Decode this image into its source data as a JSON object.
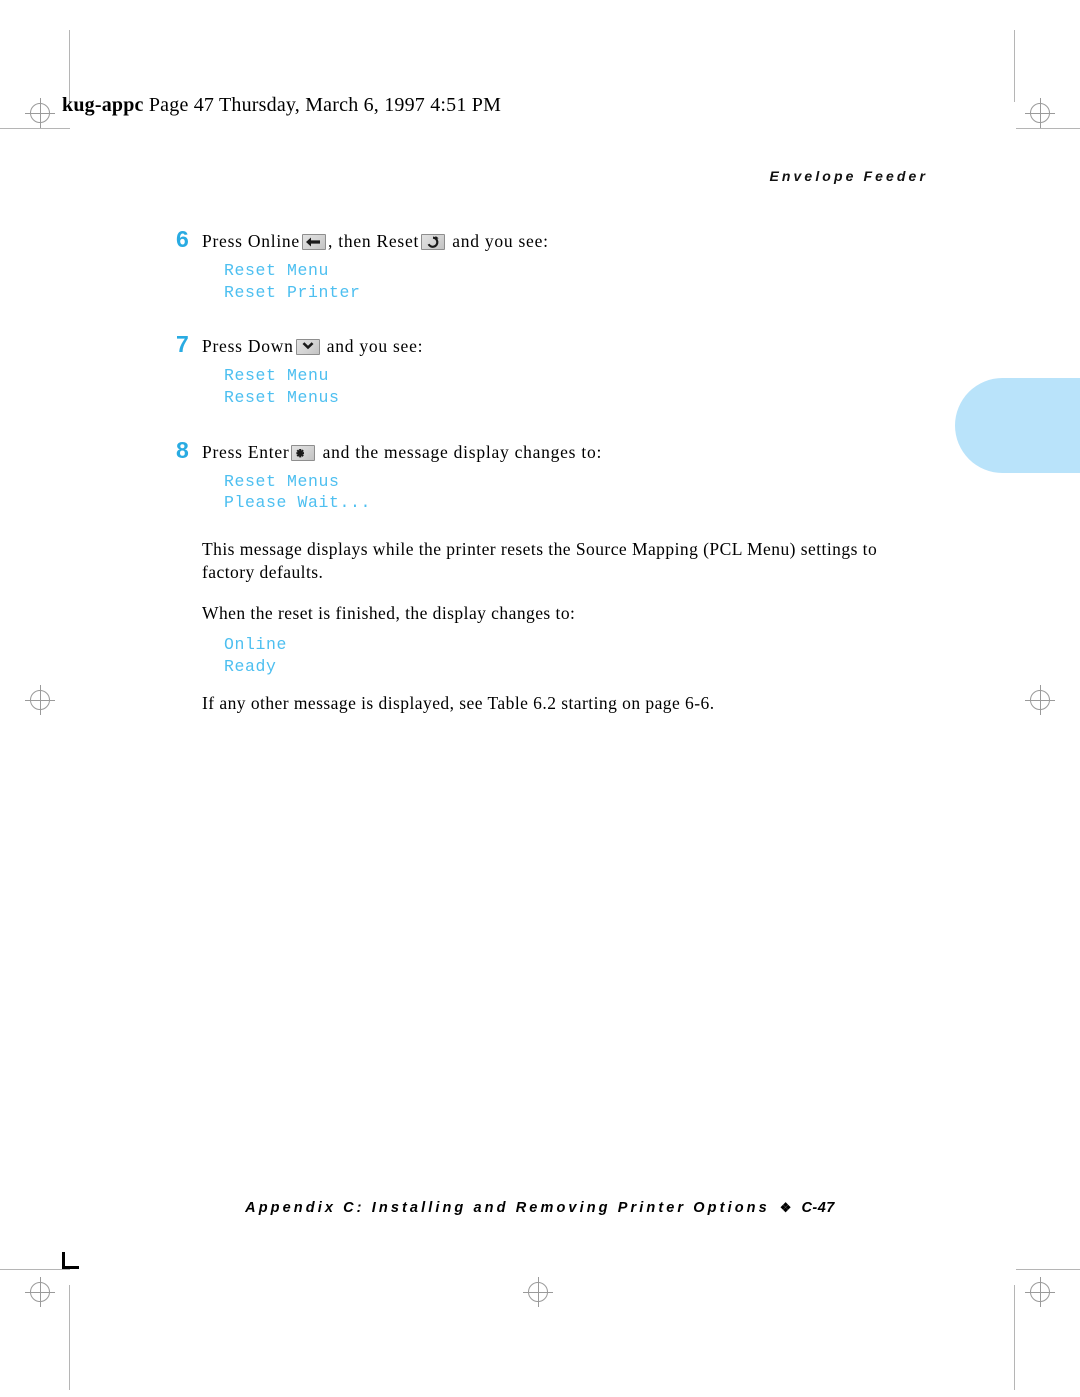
{
  "page": {
    "slug_bold": "kug-appc",
    "slug_rest": " Page 47  Thursday, March 6, 1997  4:51 PM",
    "running_head": "Envelope Feeder"
  },
  "colors": {
    "step_number": "#29abe2",
    "display_text": "#4dbff0",
    "thumb_tab": "#b9e3fa",
    "body_text": "#000000"
  },
  "steps": [
    {
      "number": "6",
      "text_before": "Press Online",
      "key1": "online-left-arrow-key",
      "text_middle": ", then Reset",
      "key2": "reset-circular-arrow-key",
      "text_after": "and you see:",
      "display": [
        "Reset Menu",
        "Reset Printer"
      ]
    },
    {
      "number": "7",
      "text_before": "Press Down",
      "key1": "down-chevron-key",
      "text_after": "and you see:",
      "display": [
        "Reset Menu",
        "Reset Menus"
      ]
    },
    {
      "number": "8",
      "text_before": "Press Enter",
      "key1": "enter-asterisk-key",
      "text_after": "and the message display changes to:",
      "display": [
        "Reset Menus",
        "Please Wait..."
      ]
    }
  ],
  "body": {
    "para1": "This message displays while the printer resets the Source Mapping (PCL Menu) settings to factory defaults.",
    "para2": "When the reset is finished, the display changes to:",
    "display2": [
      "Online",
      "Ready"
    ],
    "para3": "If any other message is displayed, see Table 6.2 starting on page 6-6."
  },
  "footer": {
    "text": "Appendix C: Installing and Removing Printer Options",
    "diamond": "❖",
    "page_number": "C-47"
  }
}
